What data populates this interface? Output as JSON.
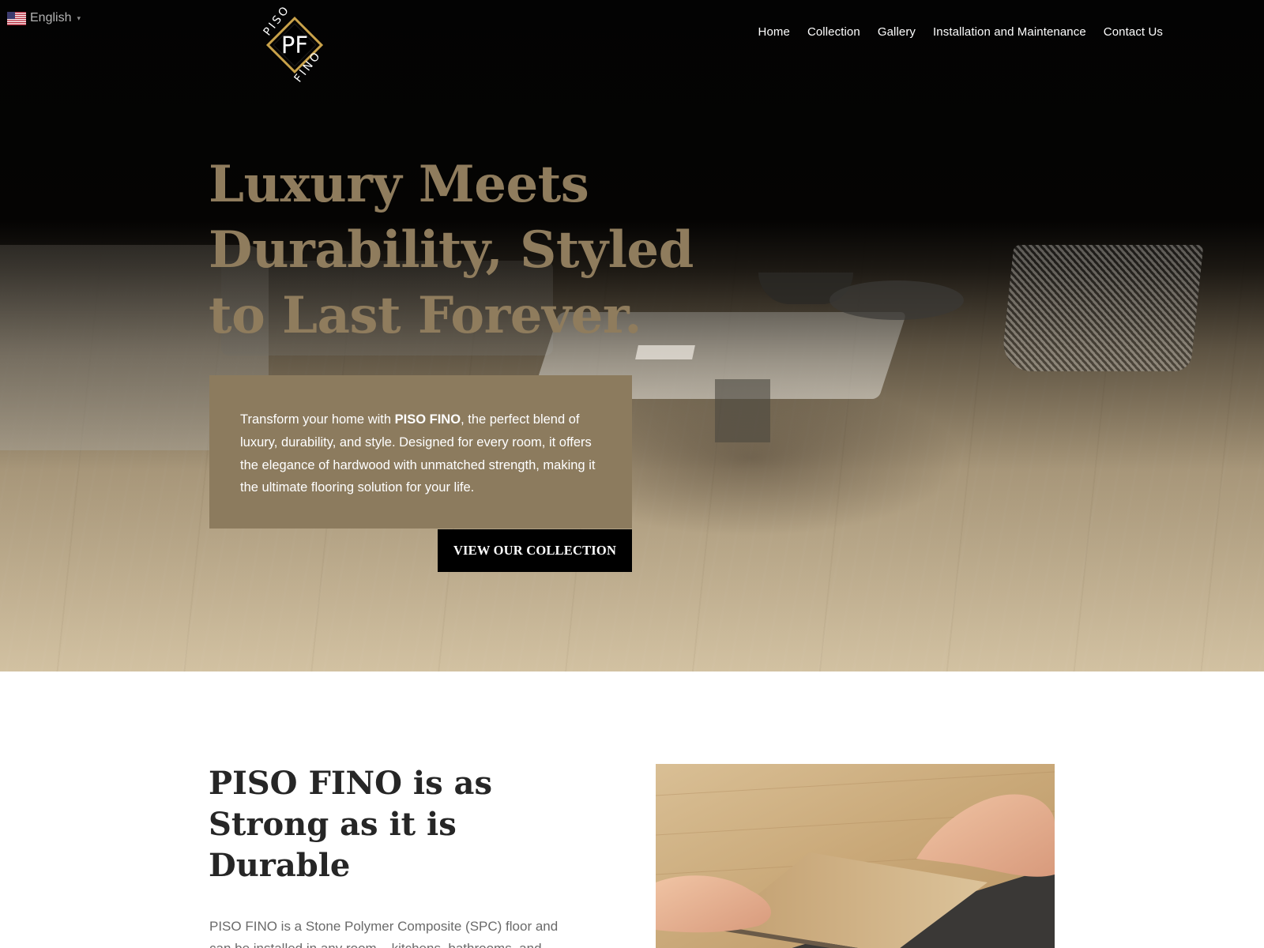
{
  "language": {
    "label": "English",
    "caret": "▾"
  },
  "logo": {
    "monogram": "PF",
    "top": "PISO",
    "bottom": "FINO"
  },
  "nav": {
    "items": [
      {
        "label": "Home"
      },
      {
        "label": "Collection"
      },
      {
        "label": "Gallery"
      },
      {
        "label": "Installation and Maintenance"
      },
      {
        "label": "Contact Us"
      }
    ]
  },
  "hero": {
    "title": "Luxury Meets Durability, Styled to Last Forever.",
    "text_before": "Transform your home with ",
    "brand": "PISO FINO",
    "text_after": ", the perfect blend of luxury, durability, and style. Designed for every room, it offers the elegance of hardwood with unmatched strength, making it the ultimate flooring solution for your life.",
    "cta_label": "VIEW OUR COLLECTION"
  },
  "section": {
    "title": "PISO FINO is as Strong as it is Durable",
    "body": "PISO FINO is a Stone Polymer Composite (SPC) floor and can be installed in any room – kitchens, bathrooms, and"
  },
  "colors": {
    "accent_gold": "#8c7b5e",
    "headline_gold": "#8f7c5d",
    "logo_gold": "#c9a24a",
    "hero_bg": "#030303"
  },
  "icons": [
    "us-flag-icon",
    "chevron-down-icon",
    "piso-fino-logo"
  ]
}
